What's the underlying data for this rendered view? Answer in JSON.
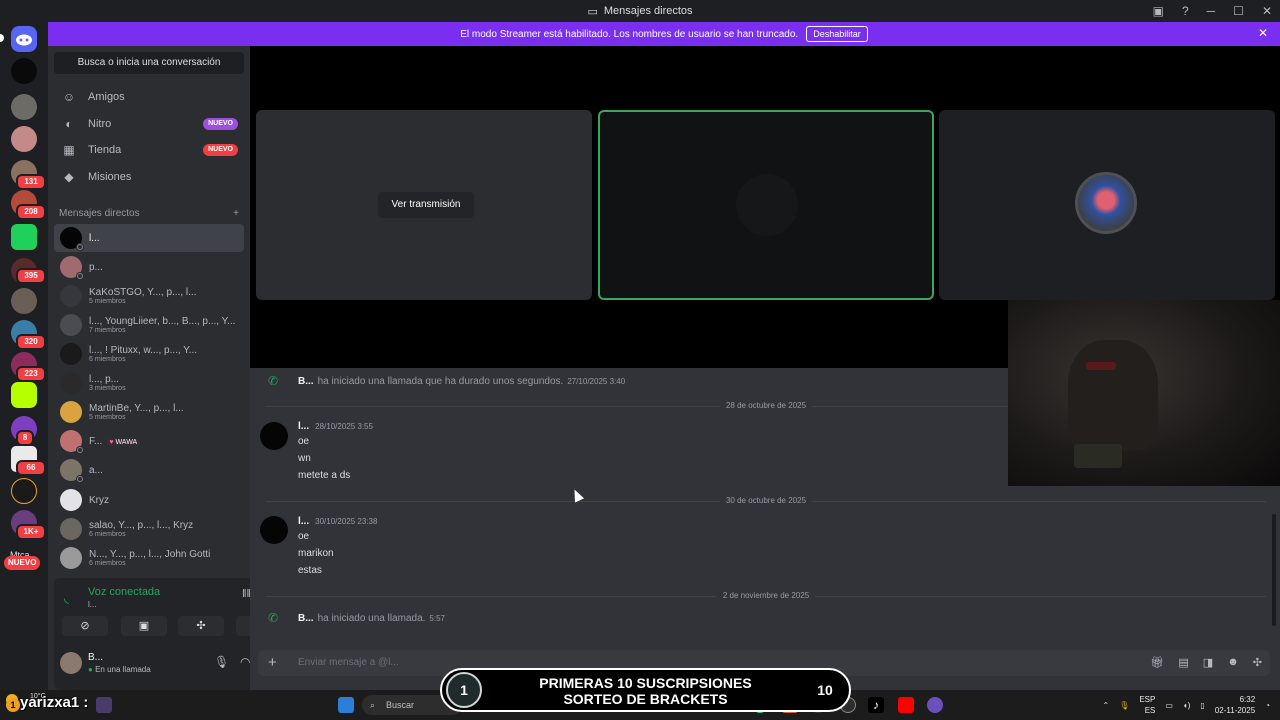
{
  "window": {
    "title": "Mensajes directos"
  },
  "banner": {
    "text": "El modo Streamer está habilitado. Los nombres de usuario se han truncado.",
    "button": "Deshabilitar"
  },
  "guilds": {
    "badges": [
      "131",
      "208",
      "395",
      "320",
      "223",
      "8",
      "66",
      "1K+"
    ],
    "new_label": "NUEVO",
    "partial_label": "Mtca"
  },
  "sidebar": {
    "search_label": "Busca o inicia una conversación",
    "nav": [
      {
        "label": "Amigos",
        "icon": "friends-icon"
      },
      {
        "label": "Nitro",
        "icon": "nitro-icon",
        "badge": "NUEVO"
      },
      {
        "label": "Tienda",
        "icon": "shop-icon",
        "badge": "NUEVO"
      },
      {
        "label": "Misiones",
        "icon": "quests-icon"
      }
    ],
    "dm_header": "Mensajes directos",
    "dm_add": "+",
    "dms": [
      {
        "name": "l...",
        "sub": ""
      },
      {
        "name": "p...",
        "sub": ""
      },
      {
        "name": "KaKoSTGO, Y..., p..., l...",
        "sub": "5 miembros"
      },
      {
        "name": "l..., YoungLiieer, b..., B..., p..., Y...",
        "sub": "7 miembros"
      },
      {
        "name": "l..., ! Pituxx, w..., p..., Y...",
        "sub": "6 miembros"
      },
      {
        "name": "l..., p...",
        "sub": "3 miembros"
      },
      {
        "name": "MartinBe, Y..., p..., l...",
        "sub": "5 miembros"
      },
      {
        "name": "F...",
        "sub": "",
        "tag": "WAWA"
      },
      {
        "name": "a...",
        "sub": ""
      },
      {
        "name": "Kryz",
        "sub": ""
      },
      {
        "name": "salao, Y..., p..., l..., Kryz",
        "sub": "6 miembros"
      },
      {
        "name": "N..., Y..., p..., l..., John Gotti",
        "sub": "6 miembros"
      }
    ],
    "voice": {
      "status": "Voz conectada",
      "channel": "l..."
    },
    "user": {
      "name": "B...",
      "status": "En una llamada"
    }
  },
  "call": {
    "watch_button": "Ver transmisión"
  },
  "chat": {
    "call_1": {
      "author": "B...",
      "text": "ha iniciado una llamada que ha durado unos segundos.",
      "time": "27/10/2025 3:40"
    },
    "divider_1": "28 de octubre de 2025",
    "msg_1": {
      "author": "l...",
      "time": "28/10/2025 3:55",
      "lines": [
        "oe",
        "wn",
        "metete a ds"
      ]
    },
    "divider_2": "30 de octubre de 2025",
    "msg_2": {
      "author": "l...",
      "time": "30/10/2025 23:38",
      "lines": [
        "oe",
        "marikon",
        "estas"
      ]
    },
    "divider_3": "2 de noviembre de 2025",
    "call_2": {
      "author": "B...",
      "text": "ha iniciado una llamada.",
      "time": "5:57"
    }
  },
  "composer": {
    "placeholder": "Enviar mensaje a @l..."
  },
  "overlay": {
    "username": "yarizxa1 :",
    "promo_line1": "PRIMERAS 10 SUSCRIPSIONES",
    "promo_line2": "SORTEO DE BRACKETS",
    "promo_left": "1",
    "promo_right": "10"
  },
  "taskbar": {
    "search": "Buscar",
    "weather_temp": "10°C",
    "lang_1": "ESP",
    "lang_2": "ES",
    "time": "6:32",
    "date": "02-11-2025",
    "whatsapp_badge": "33"
  },
  "colors": {
    "accent": "#5865f2",
    "banner": "#7a2ff0",
    "online_green": "#23a55a",
    "badge_red": "#f23f43"
  }
}
